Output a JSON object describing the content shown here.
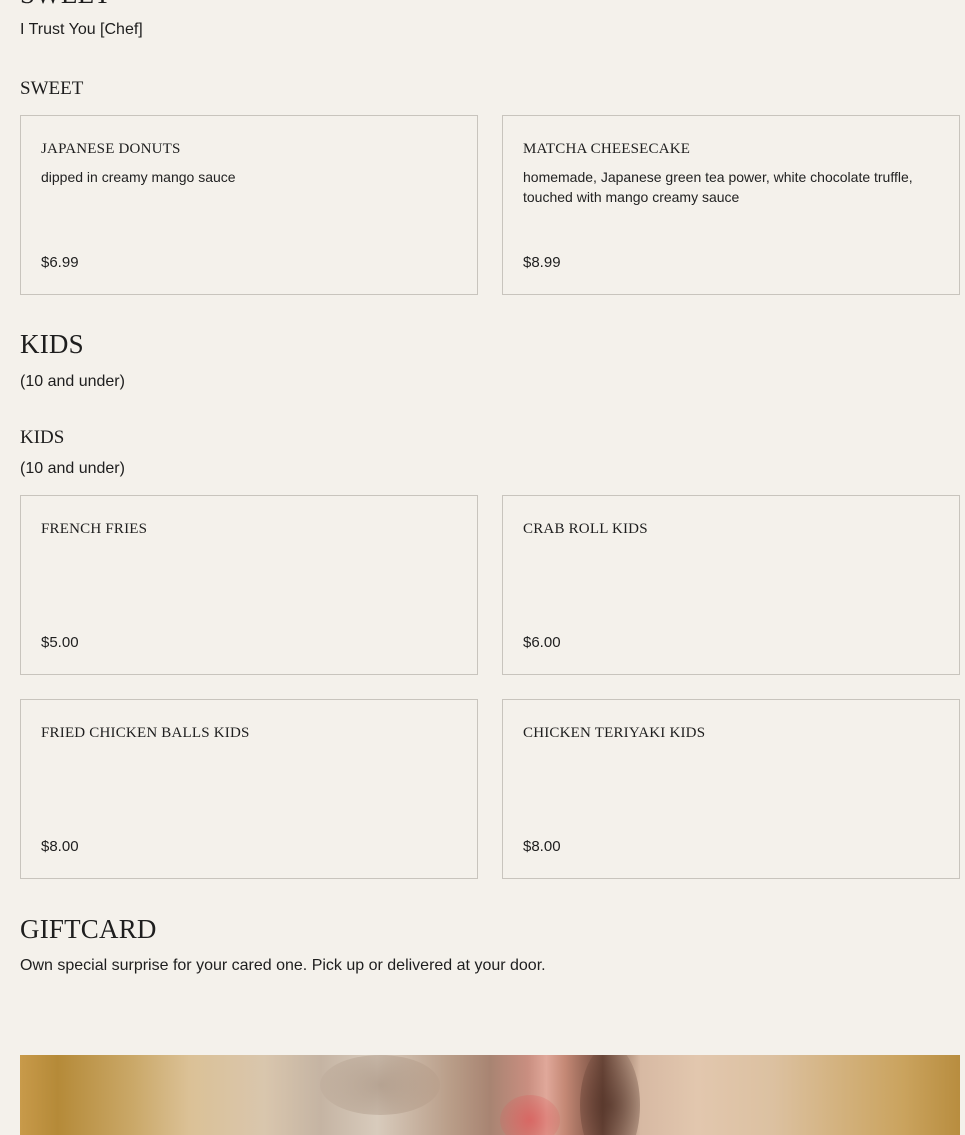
{
  "sweet_section": {
    "title": "SWEET",
    "subtitle": "I Trust You [Chef]",
    "category": "SWEET",
    "items": [
      {
        "name": "JAPANESE DONUTS",
        "description": "dipped in creamy mango sauce",
        "price": "$6.99"
      },
      {
        "name": "MATCHA CHEESECAKE",
        "description": "homemade, Japanese green tea power, white chocolate truffle, touched with mango creamy sauce",
        "price": "$8.99"
      }
    ]
  },
  "kids_section": {
    "title": "KIDS",
    "subtitle": "(10 and under)",
    "category": "KIDS",
    "category_sub": "(10 and under)",
    "items": [
      {
        "name": "FRENCH FRIES",
        "description": "",
        "price": "$5.00"
      },
      {
        "name": "CRAB ROLL KIDS",
        "description": "",
        "price": "$6.00"
      },
      {
        "name": "FRIED CHICKEN BALLS KIDS",
        "description": "",
        "price": "$8.00"
      },
      {
        "name": "CHICKEN TERIYAKI KIDS",
        "description": "",
        "price": "$8.00"
      }
    ]
  },
  "giftcard_section": {
    "title": "GIFTCARD",
    "subtitle": "Own special surprise for your cared one. Pick up or delivered at your door."
  },
  "colors": {
    "background": "#f4f1eb",
    "text": "#1e1e1e",
    "card_border": "#c8c4bd"
  }
}
